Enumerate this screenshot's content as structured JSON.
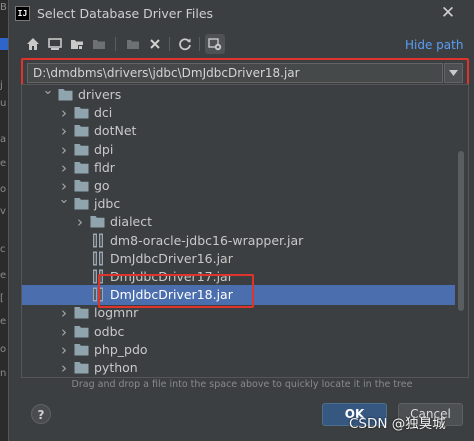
{
  "window": {
    "title": "Select Database Driver Files",
    "app_icon_text": "IJ"
  },
  "toolbar": {
    "buttons": [
      {
        "icon": "home-icon"
      },
      {
        "icon": "desktop-icon"
      },
      {
        "icon": "project-folder-icon"
      },
      {
        "icon": "module-folder-icon"
      },
      {
        "icon": "new-folder-icon"
      },
      {
        "icon": "delete-icon"
      },
      {
        "icon": "refresh-icon"
      },
      {
        "icon": "show-hidden-icon"
      }
    ],
    "hide_path_label": "Hide path"
  },
  "path_field": {
    "value": "D:\\dmdbms\\drivers\\jdbc\\DmJdbcDriver18.jar"
  },
  "tree": {
    "items": [
      {
        "label": "drivers",
        "type": "folder",
        "expanded": true,
        "depth": 0
      },
      {
        "label": "dci",
        "type": "folder",
        "expanded": false,
        "depth": 1
      },
      {
        "label": "dotNet",
        "type": "folder",
        "expanded": false,
        "depth": 1
      },
      {
        "label": "dpi",
        "type": "folder",
        "expanded": false,
        "depth": 1
      },
      {
        "label": "fldr",
        "type": "folder",
        "expanded": false,
        "depth": 1
      },
      {
        "label": "go",
        "type": "folder",
        "expanded": false,
        "depth": 1
      },
      {
        "label": "jdbc",
        "type": "folder",
        "expanded": true,
        "depth": 1
      },
      {
        "label": "dialect",
        "type": "folder",
        "expanded": false,
        "depth": 2
      },
      {
        "label": "dm8-oracle-jdbc16-wrapper.jar",
        "type": "jar",
        "depth": 2
      },
      {
        "label": "DmJdbcDriver16.jar",
        "type": "jar",
        "depth": 2
      },
      {
        "label": "DmJdbcDriver17.jar",
        "type": "jar",
        "depth": 2
      },
      {
        "label": "DmJdbcDriver18.jar",
        "type": "jar",
        "depth": 2,
        "selected": true
      },
      {
        "label": "logmnr",
        "type": "folder",
        "expanded": false,
        "depth": 1
      },
      {
        "label": "odbc",
        "type": "folder",
        "expanded": false,
        "depth": 1
      },
      {
        "label": "php_pdo",
        "type": "folder",
        "expanded": false,
        "depth": 1
      },
      {
        "label": "python",
        "type": "folder",
        "expanded": false,
        "depth": 1
      }
    ]
  },
  "hint_text": "Drag and drop a file into the space above to quickly locate it in the tree",
  "footer": {
    "help_label": "?",
    "ok_label": "OK",
    "cancel_label": "Cancel"
  },
  "watermark": "CSDN @独臭城",
  "colors": {
    "accent_link": "#589df6",
    "selection": "#4b6eaf",
    "highlight_box": "#e0332b",
    "folder": "#90a4ae"
  }
}
